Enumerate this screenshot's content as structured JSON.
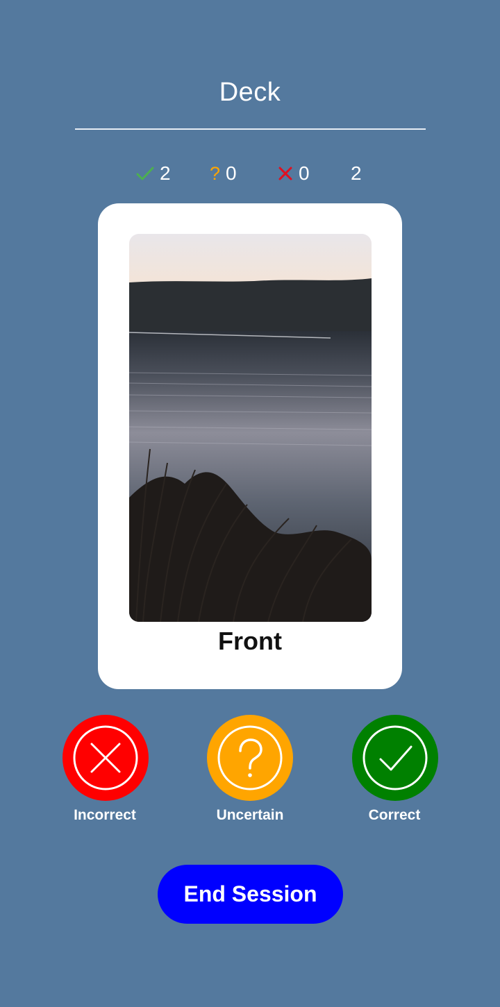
{
  "header": {
    "title": "Deck"
  },
  "stats": {
    "correct": "2",
    "uncertain": "0",
    "incorrect": "0",
    "total": "2"
  },
  "card": {
    "side_label": "Front",
    "image": "lake-landscape-photo"
  },
  "actions": {
    "incorrect_label": "Incorrect",
    "uncertain_label": "Uncertain",
    "correct_label": "Correct",
    "end_label": "End Session"
  },
  "icons": {
    "correct": "check-icon",
    "uncertain": "question-icon",
    "incorrect": "x-icon"
  },
  "colors": {
    "background": "#54799e",
    "correct": "#008000",
    "uncertain": "#ffa500",
    "incorrect": "#ff0000",
    "end_button": "#0000ff",
    "stat_check": "#4caf50",
    "stat_question": "#ffa500",
    "stat_x": "#e01020"
  }
}
